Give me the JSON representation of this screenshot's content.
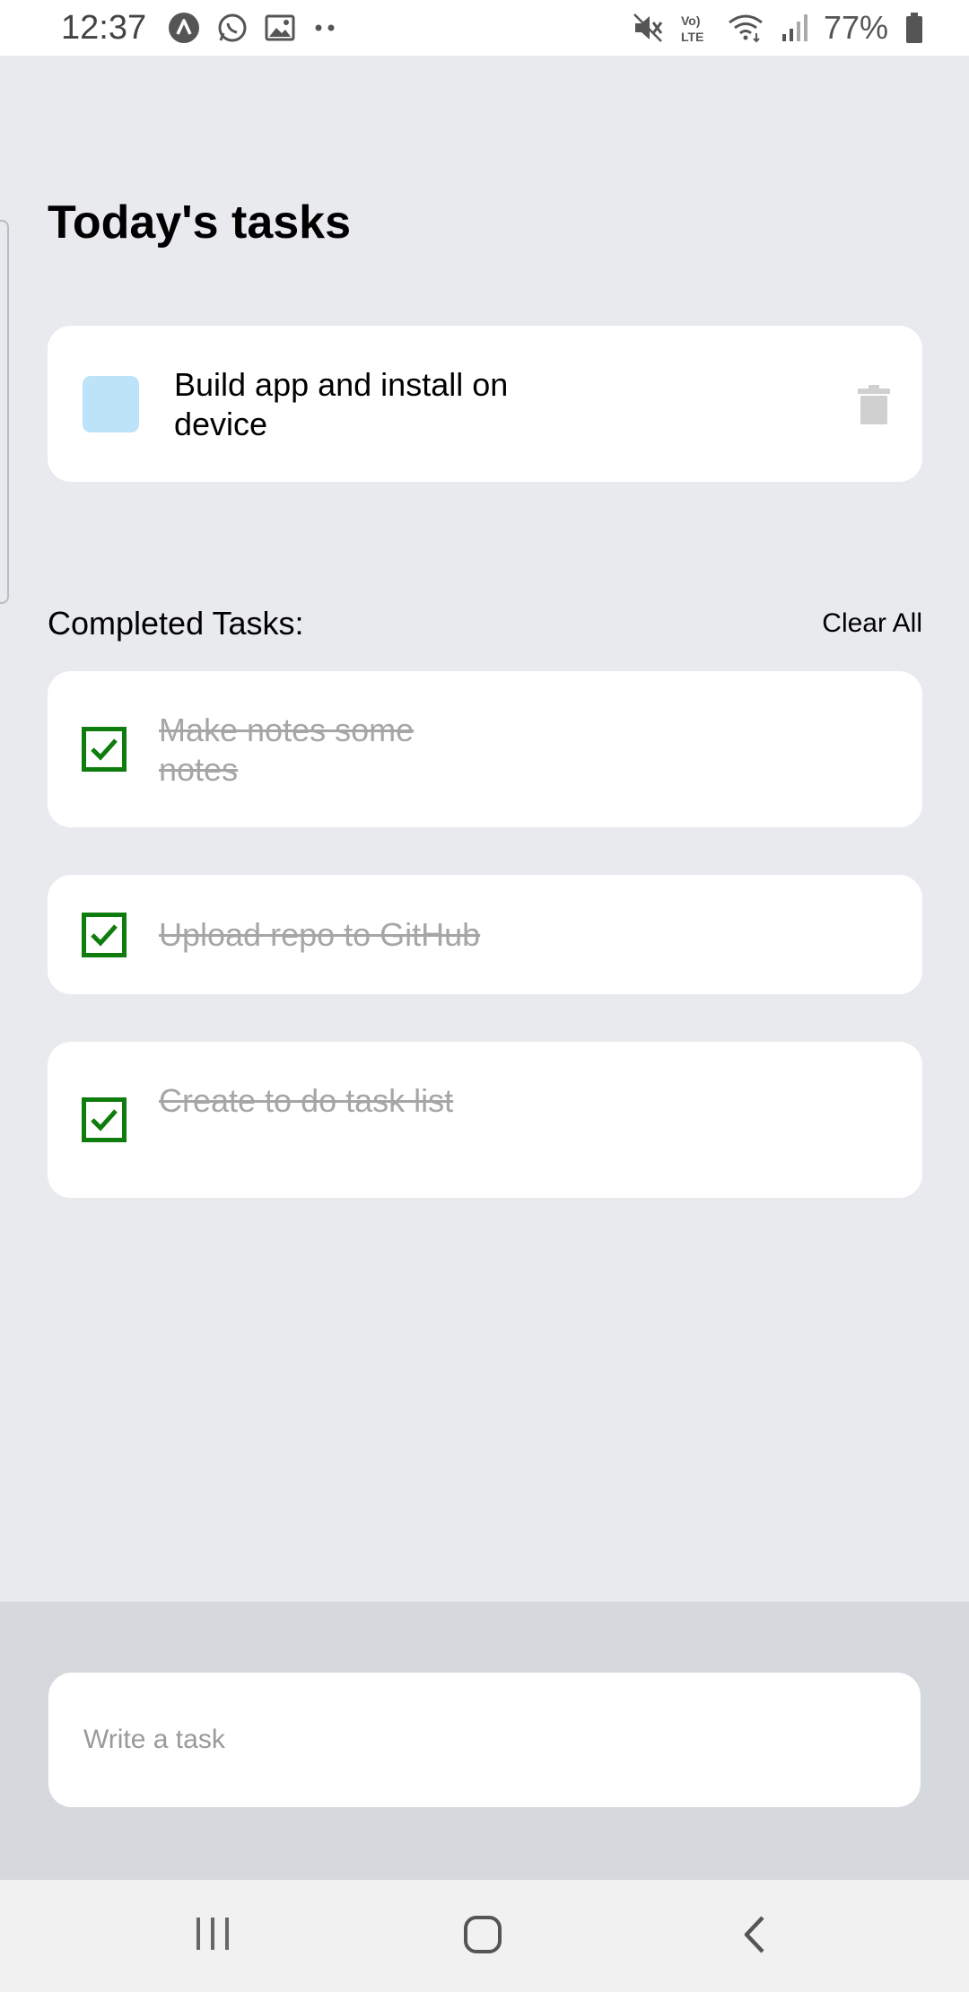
{
  "status_bar": {
    "time": "12:37",
    "battery": "77%",
    "icons": [
      "app-icon",
      "whatsapp-icon",
      "gallery-icon",
      "more-dots-icon",
      "mute-icon",
      "volte-icon",
      "wifi-icon",
      "signal-icon",
      "battery-icon"
    ]
  },
  "header": {
    "title": "Today's tasks"
  },
  "active_tasks": [
    {
      "text": "Build app and install on device",
      "checked": false
    }
  ],
  "completed": {
    "label": "Completed Tasks:",
    "clear_label": "Clear All",
    "items": [
      {
        "text": "Make notes some notes",
        "checked": true
      },
      {
        "text": "Upload repo to GitHub",
        "checked": true
      },
      {
        "text": "Create to do task list",
        "checked": true
      }
    ]
  },
  "input": {
    "placeholder": "Write a task",
    "value": ""
  },
  "colors": {
    "background": "#e8eaed",
    "card": "#ffffff",
    "checkbox_empty": "#bde3f8",
    "checkbox_done": "#0e7d0e",
    "completed_text": "#a6a6a6",
    "input_area": "#d5d8dd"
  },
  "nav": {
    "icons": [
      "recent-apps-icon",
      "home-icon",
      "back-icon"
    ]
  }
}
